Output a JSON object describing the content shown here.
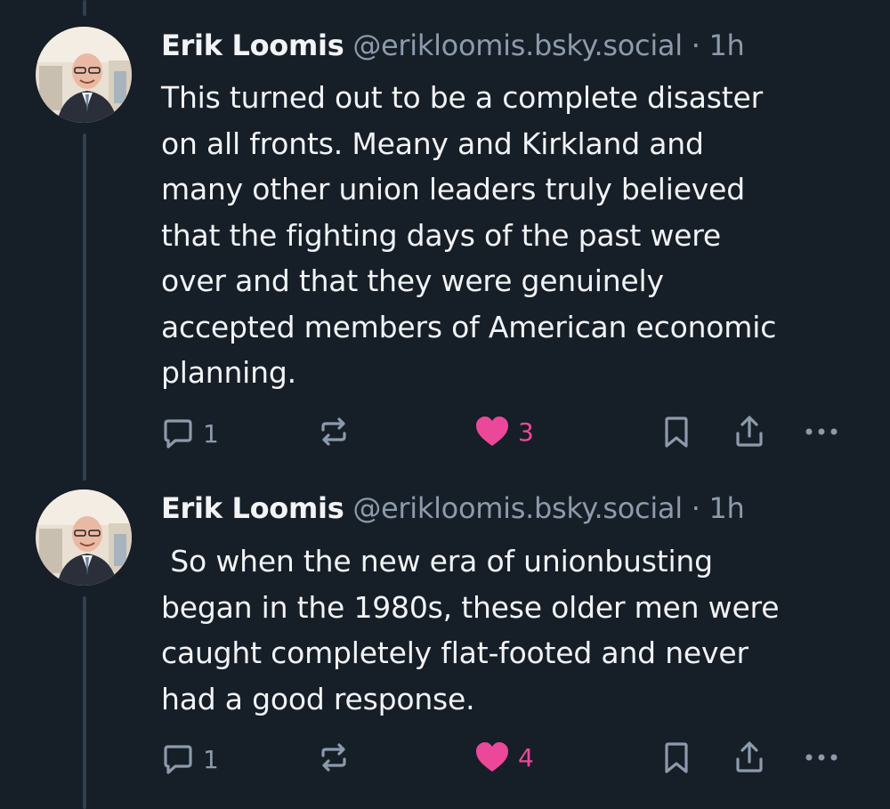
{
  "posts": [
    {
      "author_name": "Erik Loomis",
      "handle": "@erikloomis.bsky.social",
      "separator": "·",
      "time": "1h",
      "text": "This turned out to be a complete disaster\non all fronts. Meany and Kirkland and\nmany other union leaders truly believed\nthat the fighting days of the past were\nover and that they were genuinely\naccepted members of American economic\nplanning.",
      "reply_count": "1",
      "like_count": "3",
      "liked": true,
      "icons": [
        "reply-icon",
        "repost-icon",
        "heart-icon",
        "bookmark-icon",
        "share-icon",
        "more-icon"
      ]
    },
    {
      "author_name": "Erik Loomis",
      "handle": "@erikloomis.bsky.social",
      "separator": "·",
      "time": "1h",
      "text": " So when the new era of unionbusting\nbegan in the 1980s, these older men were\ncaught completely flat-footed and never\nhad a good response.",
      "reply_count": "1",
      "like_count": "4",
      "liked": true,
      "icons": [
        "reply-icon",
        "repost-icon",
        "heart-icon",
        "bookmark-icon",
        "share-icon",
        "more-icon"
      ]
    }
  ],
  "colors": {
    "background": "#161e27",
    "text": "#f1f3f5",
    "muted": "#8c9aab",
    "like": "#ec4899",
    "thread_line": "#2e4052"
  }
}
